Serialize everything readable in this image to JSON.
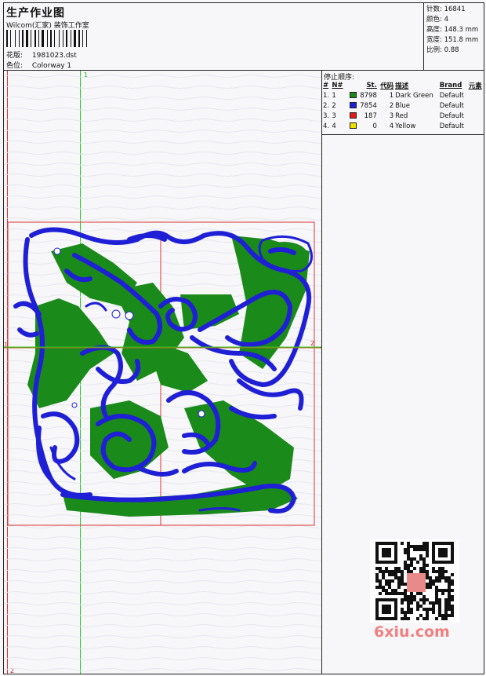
{
  "header": {
    "title": "生产作业图",
    "company": "Wilcom(汇家) 装饰工作室",
    "design_label": "花版:",
    "design_value": "1981023.dst",
    "colorway_label": "色位:",
    "colorway_value": "Colorway 1"
  },
  "stats": {
    "stitches_label": "针数:",
    "stitches_value": "16841",
    "colors_label": "颜色:",
    "colors_value": "4",
    "height_label": "高度:",
    "height_value": "148.3 mm",
    "width_label": "宽度:",
    "width_value": "151.8 mm",
    "scale_label": "比例:",
    "scale_value": "0.88"
  },
  "stop_sequence": {
    "title": "停止顺序:",
    "columns": [
      "#",
      "N#",
      "St.",
      "代码",
      "描述",
      "Brand",
      "元素"
    ],
    "rows": [
      {
        "idx": "1.",
        "n": "1",
        "color": "#1a8a1a",
        "st": "8798",
        "code": "1",
        "desc": "Dark Green",
        "brand": "Default"
      },
      {
        "idx": "2.",
        "n": "2",
        "color": "#1f1fd6",
        "st": "7854",
        "code": "2",
        "desc": "Blue",
        "brand": "Default"
      },
      {
        "idx": "3.",
        "n": "3",
        "color": "#e01a1a",
        "st": "187",
        "code": "3",
        "desc": "Red",
        "brand": "Default"
      },
      {
        "idx": "4.",
        "n": "4",
        "color": "#f0e000",
        "st": "0",
        "code": "4",
        "desc": "Yellow",
        "brand": "Default"
      }
    ]
  },
  "rulers": {
    "top_marker": "1",
    "left_marker": "1",
    "right_marker": "2",
    "bottom_marker": "2"
  },
  "colors": {
    "green": "#1a8a1a",
    "blue": "#1f1fd6",
    "red": "#e01a1a",
    "guide_green": "#22cc22"
  },
  "watermark": {
    "text": "6xiu.com"
  }
}
